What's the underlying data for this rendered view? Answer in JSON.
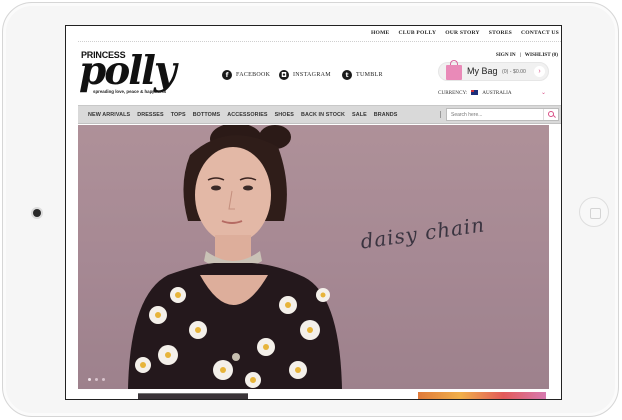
{
  "topnav": [
    "HOME",
    "CLUB POLLY",
    "OUR STORY",
    "STORES",
    "CONTACT US"
  ],
  "logo": {
    "line1": "PRINCESS",
    "line2": "polly",
    "tagline": "spreading love, peace & happiness"
  },
  "social": [
    {
      "icon": "facebook-icon",
      "glyph": "f",
      "label": "FACEBOOK"
    },
    {
      "icon": "instagram-icon",
      "glyph": "◘",
      "label": "INSTAGRAM"
    },
    {
      "icon": "tumblr-icon",
      "glyph": "t",
      "label": "TUMBLR"
    }
  ],
  "account": {
    "sign_in": "SIGN IN",
    "separator": "|",
    "wishlist": "WISHLIST (0)"
  },
  "bag": {
    "label": "My Bag",
    "total": "(0) - $0.00",
    "arrow": "›"
  },
  "currency": {
    "label": "CURRENCY:",
    "country": "AUSTRALIA",
    "chevron": "⌄"
  },
  "categories": [
    "NEW ARRIVALS",
    "DRESSES",
    "TOPS",
    "BOTTOMS",
    "ACCESSORIES",
    "SHOES",
    "BACK IN STOCK",
    "SALE",
    "BRANDS"
  ],
  "search": {
    "placeholder": "Search here..."
  },
  "hero": {
    "caption": "daisy chain",
    "slides": 3,
    "active_slide": 1
  },
  "colors": {
    "accent": "#d84d84",
    "bag_pink": "#e98ab8",
    "hero_bg": "#a58793"
  }
}
